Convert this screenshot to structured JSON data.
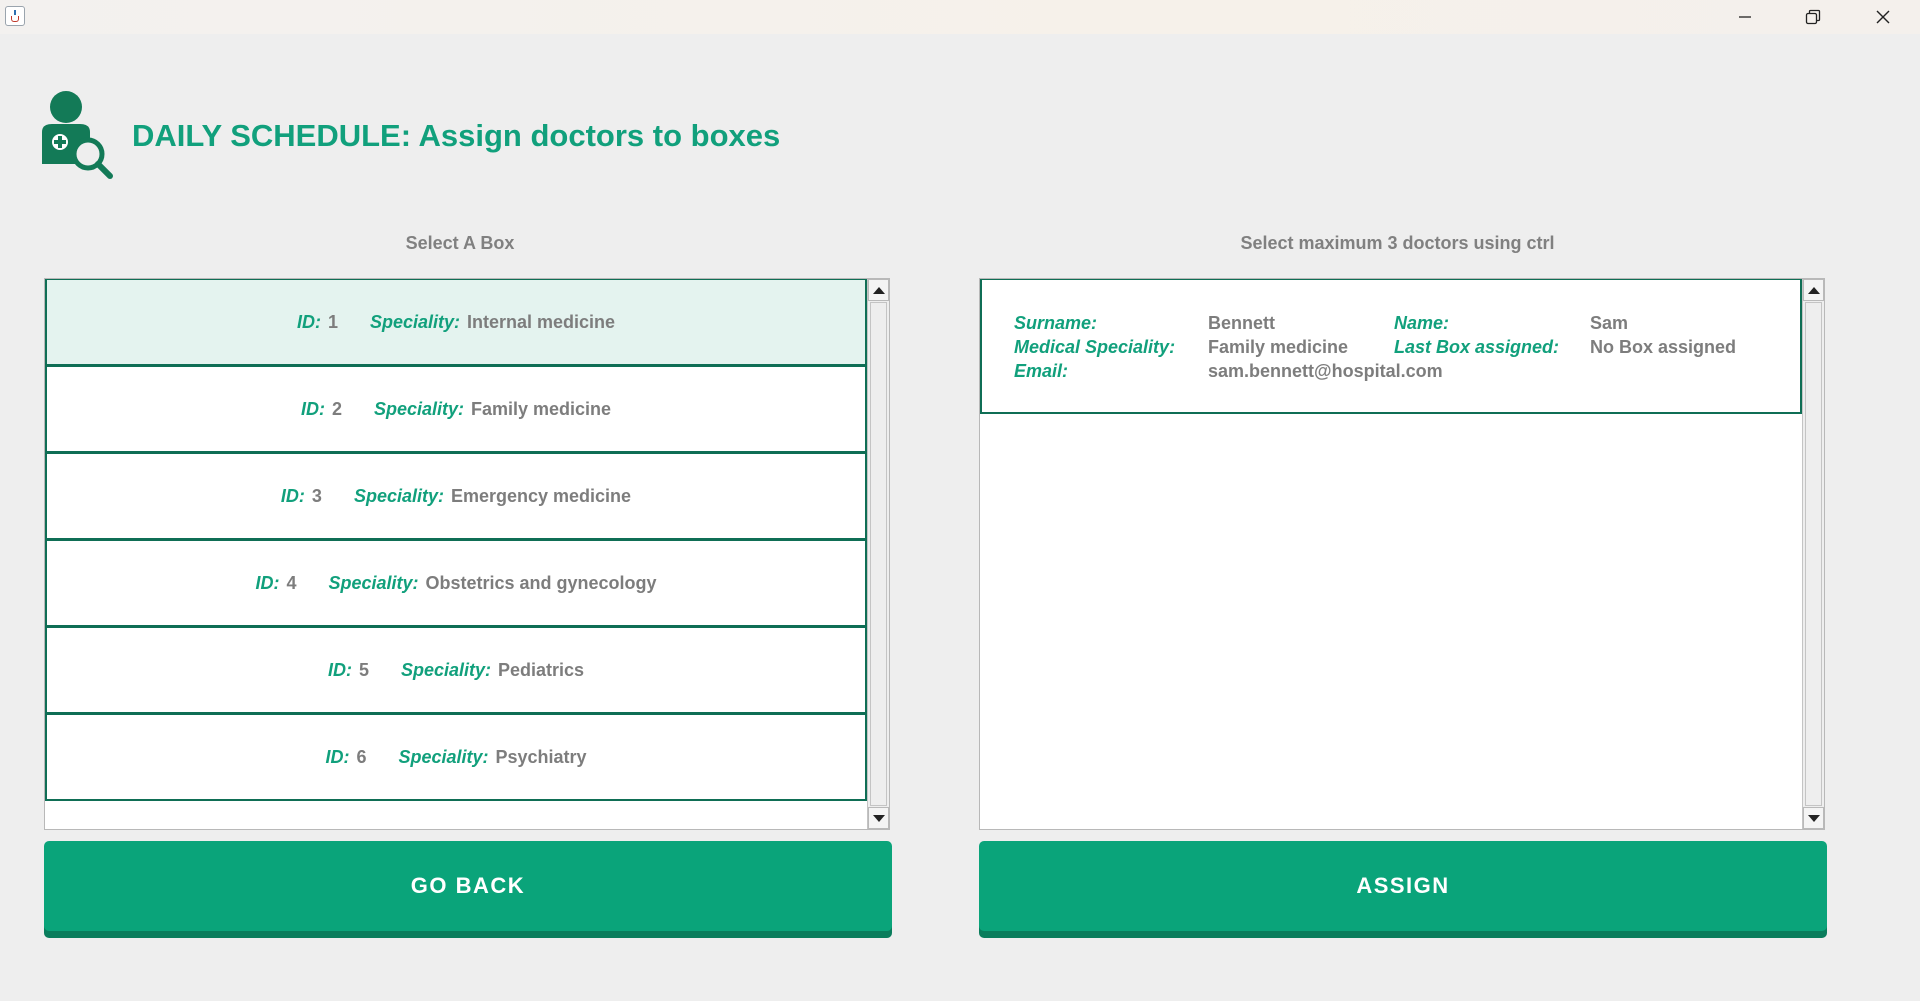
{
  "window": {
    "minimize_icon": "minimize-icon",
    "maximize_icon": "restore-icon",
    "close_icon": "close-icon"
  },
  "header": {
    "title": "DAILY SCHEDULE: Assign doctors to boxes",
    "logo_icon": "doctor-search-icon"
  },
  "boxes": {
    "label": "Select A Box",
    "id_label": "ID:",
    "speciality_label": "Speciality:",
    "items": [
      {
        "id": "1",
        "speciality": "Internal medicine",
        "selected": true
      },
      {
        "id": "2",
        "speciality": "Family medicine",
        "selected": false
      },
      {
        "id": "3",
        "speciality": "Emergency medicine",
        "selected": false
      },
      {
        "id": "4",
        "speciality": "Obstetrics and gynecology",
        "selected": false
      },
      {
        "id": "5",
        "speciality": "Pediatrics",
        "selected": false
      },
      {
        "id": "6",
        "speciality": "Psychiatry",
        "selected": false
      }
    ]
  },
  "doctors": {
    "label": "Select maximum 3 doctors using ctrl",
    "items": [
      {
        "surname_label": "Surname:",
        "surname": "Bennett",
        "name_label": "Name:",
        "name": "Sam",
        "speciality_label": "Medical Speciality:",
        "speciality": "Family medicine",
        "last_box_label": "Last Box assigned:",
        "last_box": "No Box assigned",
        "email_label": "Email:",
        "email": "sam.bennett@hospital.com"
      }
    ]
  },
  "buttons": {
    "go_back": "GO BACK",
    "assign": "ASSIGN"
  },
  "colors": {
    "accent": "#11a07c",
    "button": "#0aa47a",
    "border": "#0f6e55",
    "selected_row": "#e4f3ef",
    "value_text": "#7d7d7d"
  }
}
